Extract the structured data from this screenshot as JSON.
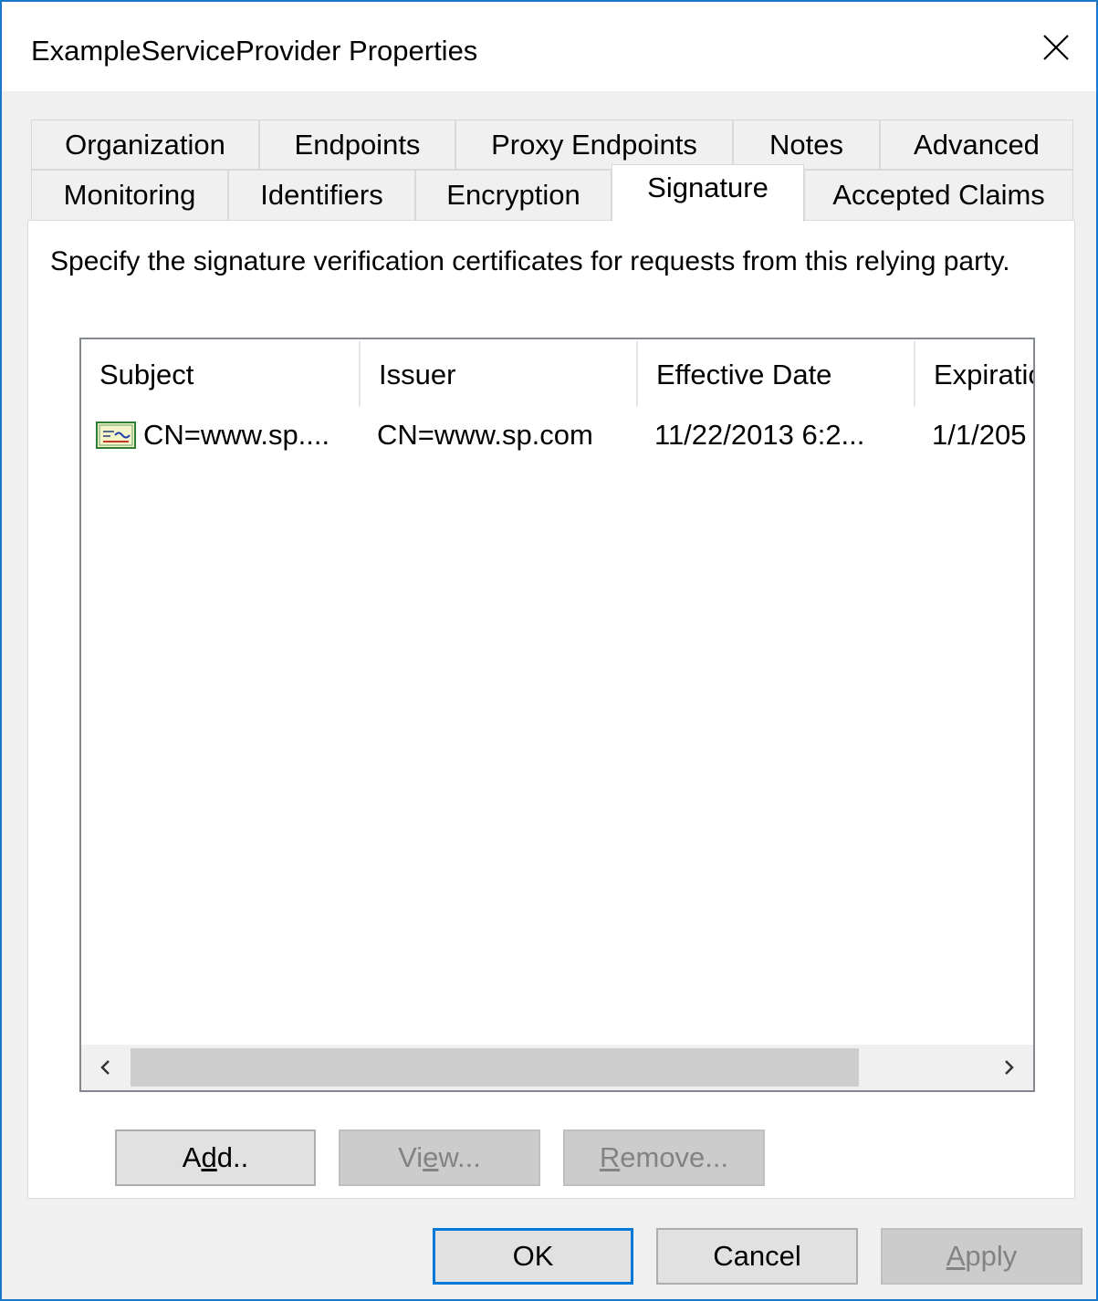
{
  "window": {
    "title": "ExampleServiceProvider Properties"
  },
  "tabs": {
    "row1": [
      {
        "label": "Organization"
      },
      {
        "label": "Endpoints"
      },
      {
        "label": "Proxy Endpoints"
      },
      {
        "label": "Notes"
      },
      {
        "label": "Advanced"
      }
    ],
    "row2": [
      {
        "label": "Monitoring"
      },
      {
        "label": "Identifiers"
      },
      {
        "label": "Encryption"
      },
      {
        "label": "Signature",
        "active": true
      },
      {
        "label": "Accepted Claims"
      }
    ]
  },
  "panel": {
    "description": "Specify the signature verification certificates for requests from this relying party.",
    "columns": [
      "Subject",
      "Issuer",
      "Effective Date",
      "Expiratic"
    ],
    "rows": [
      {
        "icon": "certificate-icon",
        "subject": "CN=www.sp....",
        "issuer": "CN=www.sp.com",
        "effective_date": "11/22/2013 6:2...",
        "expiration": "1/1/205"
      }
    ],
    "buttons": {
      "add": {
        "pre": "A",
        "mnemonic": "d",
        "post": "d.."
      },
      "view": {
        "pre": "Vi",
        "mnemonic": "e",
        "post": "w...",
        "disabled": true
      },
      "remove": {
        "pre": "",
        "mnemonic": "R",
        "post": "emove...",
        "disabled": true
      }
    }
  },
  "footer": {
    "ok": "OK",
    "cancel": "Cancel",
    "apply": {
      "pre": "",
      "mnemonic": "A",
      "post": "pply",
      "disabled": true
    }
  },
  "colors": {
    "window_border": "#1a78c8",
    "dialog_background": "#f0f0f0",
    "default_button_border": "#0078d7"
  }
}
